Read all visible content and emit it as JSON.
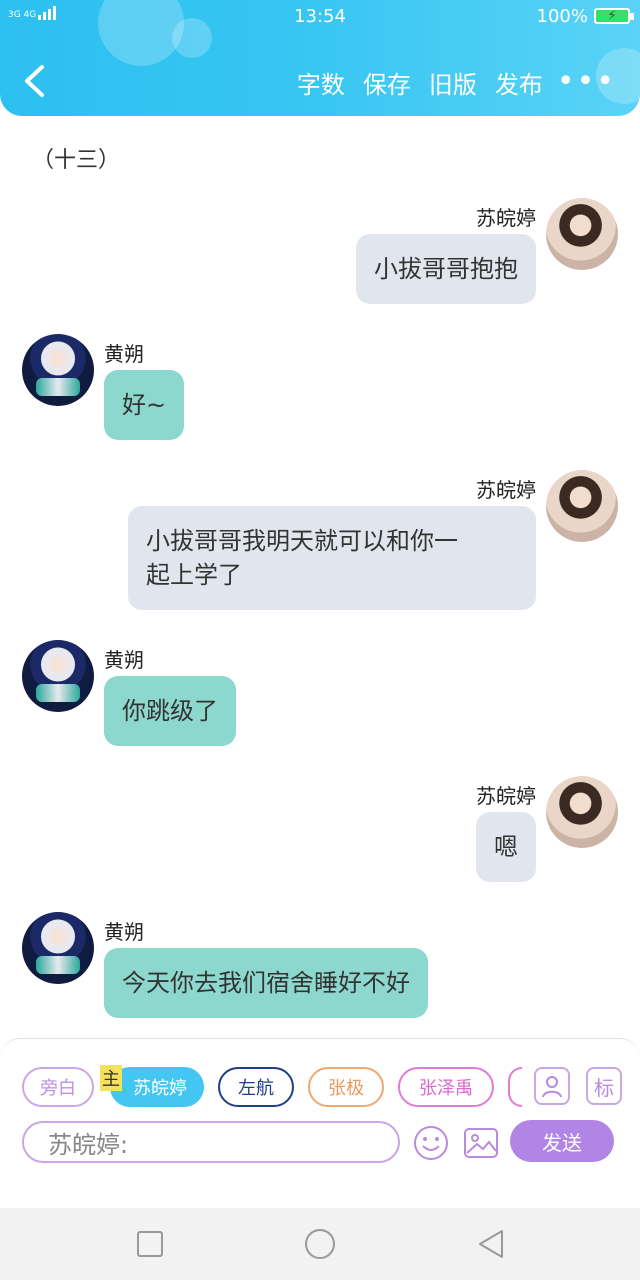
{
  "status_bar": {
    "network": "3G 4G",
    "time": "13:54",
    "battery": "100%"
  },
  "toolbar": {
    "actions": [
      "字数",
      "保存",
      "旧版",
      "发布"
    ],
    "more": "•••"
  },
  "chapter_title": "（十三）",
  "messages": [
    {
      "side": "right",
      "name": "苏皖婷",
      "text_lines": [
        "小拔哥哥抱抱"
      ]
    },
    {
      "side": "left",
      "name": "黄朔",
      "text_lines": [
        "好~"
      ]
    },
    {
      "side": "right",
      "name": "苏皖婷",
      "text_lines": [
        "小拔哥哥我明天就可以和你一",
        "起上学了"
      ]
    },
    {
      "side": "left",
      "name": "黄朔",
      "text_lines": [
        "你跳级了"
      ]
    },
    {
      "side": "right",
      "name": "苏皖婷",
      "text_lines": [
        "嗯"
      ]
    },
    {
      "side": "left",
      "name": "黄朔",
      "text_lines": [
        "今天你去我们宿舍睡好不好"
      ]
    }
  ],
  "composer": {
    "chips": [
      {
        "label": "旁白",
        "color": "#c9a7e6"
      },
      {
        "label": "苏皖婷",
        "color": "#44c6f2",
        "active": true
      },
      {
        "label": "左航",
        "color": "#1f3f8a"
      },
      {
        "label": "张极",
        "color": "#f0a870"
      },
      {
        "label": "张泽禹",
        "color": "#e27ad6"
      }
    ],
    "main_tag": "主",
    "mark_button": "标",
    "input_value": "苏皖婷:",
    "send_label": "发送"
  }
}
